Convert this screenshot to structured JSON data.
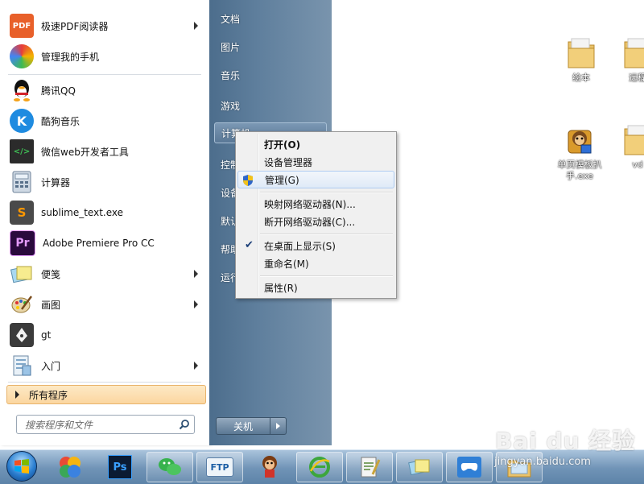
{
  "start_menu": {
    "programs": [
      {
        "label": "极速PDF阅读器",
        "icon": "pdf-reader-icon",
        "submenu": true
      },
      {
        "label": "管理我的手机",
        "icon": "phone-manager-icon",
        "submenu": false
      },
      {
        "label": "腾讯QQ",
        "icon": "qq-penguin-icon",
        "submenu": false
      },
      {
        "label": "酷狗音乐",
        "icon": "kugou-music-icon",
        "submenu": false
      },
      {
        "label": "微信web开发者工具",
        "icon": "wechat-devtools-icon",
        "submenu": false
      },
      {
        "label": "计算器",
        "icon": "calculator-icon",
        "submenu": false
      },
      {
        "label": "sublime_text.exe",
        "icon": "sublime-text-icon",
        "submenu": false
      },
      {
        "label": "Adobe Premiere Pro CC",
        "icon": "premiere-pro-icon",
        "submenu": false
      },
      {
        "label": "便笺",
        "icon": "sticky-notes-icon",
        "submenu": true
      },
      {
        "label": "画图",
        "icon": "paint-icon",
        "submenu": true
      },
      {
        "label": "gt",
        "icon": "gt-pen-icon",
        "submenu": false
      },
      {
        "label": "入门",
        "icon": "getting-started-icon",
        "submenu": true
      }
    ],
    "all_programs": "所有程序",
    "search_placeholder": "搜索程序和文件",
    "right_items": [
      "文档",
      "图片",
      "音乐",
      "游戏",
      "计算机",
      "控制面板",
      "设备和打印机",
      "默认程序",
      "帮助和支持",
      "运行..."
    ],
    "right_items_visible": [
      "文档",
      "图片",
      "音乐",
      "游戏",
      "计算机",
      "控制",
      "设备",
      "默认",
      "帮助",
      "运行"
    ],
    "shutdown": "关机"
  },
  "context_menu": {
    "items": [
      {
        "label": "打开(O)",
        "bold": true
      },
      {
        "label": "设备管理器"
      },
      {
        "label": "管理(G)",
        "hover": true,
        "icon": "uac-shield-icon"
      },
      {
        "label": "映射网络驱动器(N)..."
      },
      {
        "label": "断开网络驱动器(C)..."
      },
      {
        "label": "在桌面上显示(S)",
        "checked": true
      },
      {
        "label": "重命名(M)"
      },
      {
        "label": "属性(R)"
      }
    ]
  },
  "desktop": {
    "icons": [
      {
        "label": "绘本",
        "icon": "folder-icon"
      },
      {
        "label": "远程",
        "icon": "folder-icon"
      },
      {
        "label": "单页模板扒手.exe",
        "icon": "monkey-app-icon"
      },
      {
        "label": "vd",
        "icon": "folder-icon"
      }
    ]
  },
  "taskbar": {
    "apps": [
      "windows-start-orb",
      "rainbow-app-icon",
      "photoshop-icon",
      "wechat-icon",
      "cuteftp-icon",
      "monkey-game-icon",
      "ie-browser-icon",
      "notepad-plus-icon",
      "sticky-notes-icon",
      "game-controller-icon",
      "file-explorer-icon"
    ],
    "ps_label": "Ps",
    "cuteftp_label": "FTP"
  },
  "watermark": {
    "brand": "Bai du 经验",
    "url": "jingyan.baidu.com"
  },
  "colors": {
    "menu_right_bg": "#5f7f9d",
    "all_programs_bg": "#fbd6a0",
    "context_hover": "#dfeaf7",
    "taskbar": "#6f93b6"
  }
}
